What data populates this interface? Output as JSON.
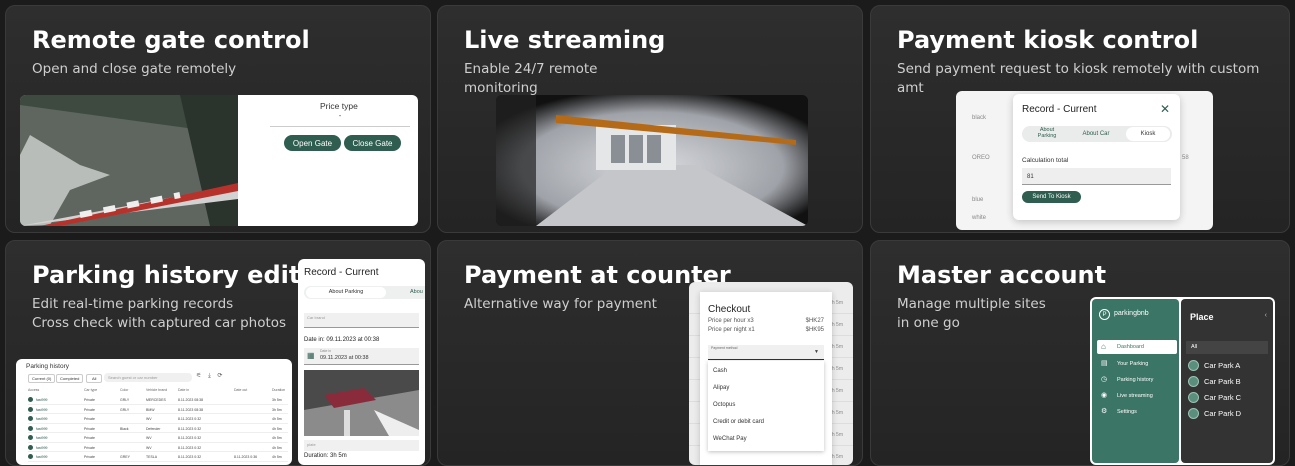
{
  "cards": [
    {
      "title": "Remote gate control",
      "desc": "Open and close gate remotely"
    },
    {
      "title": "Live streaming",
      "desc": "Enable 24/7 remote\nmonitoring"
    },
    {
      "title": "Payment kiosk control",
      "desc": "Send payment request to kiosk remotely with custom\namt"
    },
    {
      "title": "Parking history edit",
      "desc": "Edit real-time parking records\nCross check with captured car photos"
    },
    {
      "title": "Payment at counter",
      "desc": "Alternative way for payment"
    },
    {
      "title": "Master account",
      "desc": "Manage multiple sites\nin one go"
    }
  ],
  "gate": {
    "price_type_label": "Price type",
    "price_type_value": "-",
    "open_label": "Open Gate",
    "close_label": "Close Gate"
  },
  "kiosk": {
    "dialog_title": "Record - Current",
    "tabs": [
      "About\nParking",
      "About Car",
      "Kiosk"
    ],
    "calc_label": "Calculation total",
    "calc_value": "81",
    "send_label": "Send To Kiosk",
    "bg_labels": [
      "black",
      "OREO",
      "blue",
      "white"
    ],
    "bg_side": "58"
  },
  "history": {
    "title": "Parking history",
    "filters": [
      "Current (0)",
      "Completed",
      "All"
    ],
    "search_placeholder": "Search guest or car number",
    "columns": [
      "Access",
      "Car type",
      "Color",
      "Vehicle brand",
      "Date in",
      "Date out",
      "Duration"
    ],
    "rows": [
      [
        "fast999",
        "Private",
        "GRLY",
        "MERCEDES",
        "8.11.2023 08:38",
        "",
        "3h 5m"
      ],
      [
        "fast999",
        "Private",
        "GRLY",
        "BMW",
        "8.11.2023 08:38",
        "",
        "3h 5m"
      ],
      [
        "fast999",
        "Private",
        "",
        "WV",
        "8.11.2023 0:32",
        "",
        "4h 5m"
      ],
      [
        "fast999",
        "Private",
        "Black",
        "Defender",
        "8.11.2023 0:32",
        "",
        "4h 5m"
      ],
      [
        "fast999",
        "Private",
        "",
        "WV",
        "8.11.2023 0:32",
        "",
        "4h 5m"
      ],
      [
        "fast999",
        "Private",
        "",
        "WV",
        "8.11.2023 0:32",
        "",
        "4h 5m"
      ],
      [
        "fast999",
        "Private",
        "GREY",
        "TESLA",
        "8.11.2023 0:32",
        "8.11.2023 0:36",
        "4h 5m"
      ]
    ],
    "record_title": "Record - Current",
    "record_tabs": [
      "About Parking",
      "Abou"
    ],
    "car_brand_placeholder": "Car brand",
    "date_in_label": "Date in:",
    "date_in_value": "09.11.2023 at 00:38",
    "date_field_label": "Date in",
    "date_field_value": "09.11.2023 at 00:38",
    "plate_label": "plate",
    "duration_label": "Duration:",
    "duration_value": "3h 5m"
  },
  "checkout": {
    "title": "Checkout",
    "lines": [
      {
        "label": "Price per hour x3",
        "value": "$HK27"
      },
      {
        "label": "Price per night x1",
        "value": "$HK95"
      }
    ],
    "method_label": "Payment method",
    "options": [
      "Cash",
      "Alipay",
      "Octopus",
      "Credit or debit card",
      "WeChat Pay"
    ],
    "bg_side": [
      "3h 5m",
      "3h 5m",
      "4h 5m",
      "4h 5m",
      "4h 5m",
      "4h 5m",
      "4h 5m",
      "4h 5m"
    ]
  },
  "master": {
    "logo": "parkingbnb",
    "menu": [
      "Dashboard",
      "Your Parking",
      "Parking history",
      "Live streaming",
      "Settings"
    ],
    "place_title": "Place",
    "all_label": "All",
    "places": [
      "Car Park A",
      "Car Park B",
      "Car Park C",
      "Car Park D"
    ]
  },
  "colors": {
    "accent": "#2f5d50",
    "master_bg": "#3b7565",
    "dark_panel": "#333333"
  }
}
